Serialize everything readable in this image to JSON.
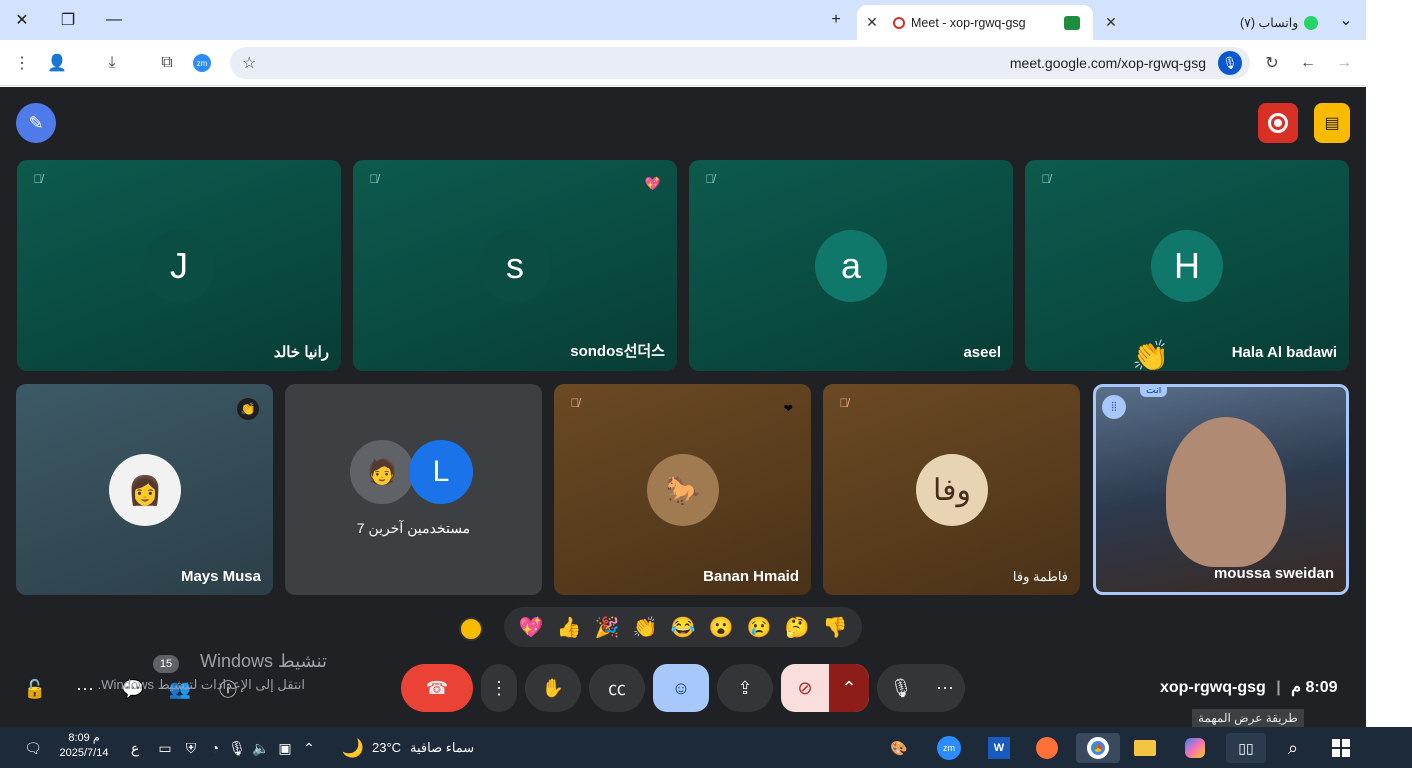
{
  "browser": {
    "tabs": [
      {
        "label": "واتساب (٧)"
      },
      {
        "label": "Meet - xop-rgwq-gsg"
      }
    ],
    "url": "meet.google.com/xop-rgwq-gsg",
    "zm_label": "zm"
  },
  "meet": {
    "top_row": [
      {
        "name": "رانيا خالد",
        "initial": "J",
        "avatar_color": "#0b5a4e"
      },
      {
        "name": "sondos선더스",
        "initial": "s",
        "avatar_color": "#0b5a4e"
      },
      {
        "name": "aseel",
        "initial": "a",
        "avatar_color": "#10786a"
      },
      {
        "name": "Hala Al badawi",
        "initial": "H",
        "avatar_color": "#10786a"
      }
    ],
    "bottom_row": [
      {
        "name": "Mays Musa"
      },
      {
        "name": "7 مستخدمين آخرين",
        "initial": "L"
      },
      {
        "name": "Banan Hmaid"
      },
      {
        "name": "فاطمة وفا",
        "logo_text": "وفا"
      },
      {
        "name": "moussa sweidan",
        "you_label": "أنت"
      }
    ],
    "reactions": [
      "💖",
      "👍",
      "🎉",
      "👏",
      "😂",
      "😮",
      "😢",
      "🤔",
      "👎"
    ],
    "meeting_code": "xop-rgwq-gsg",
    "time": "8:09 م",
    "participants_count": "15",
    "activation_title": "تنشيط Windows",
    "activation_sub": "انتقل إلى الإعدادات لتنشيط Windows.",
    "tooltip": "طريقة عرض المهمة"
  },
  "taskbar": {
    "weather": "سماء صافية",
    "temp": "23°C",
    "time": "8:09 م",
    "date": "2025/7/14",
    "lang": "ع"
  },
  "colors": {
    "accent_blue": "#4f7bea",
    "end_call_red": "#ea4335",
    "record_red": "#d93025",
    "yellow": "#f9bb00"
  }
}
